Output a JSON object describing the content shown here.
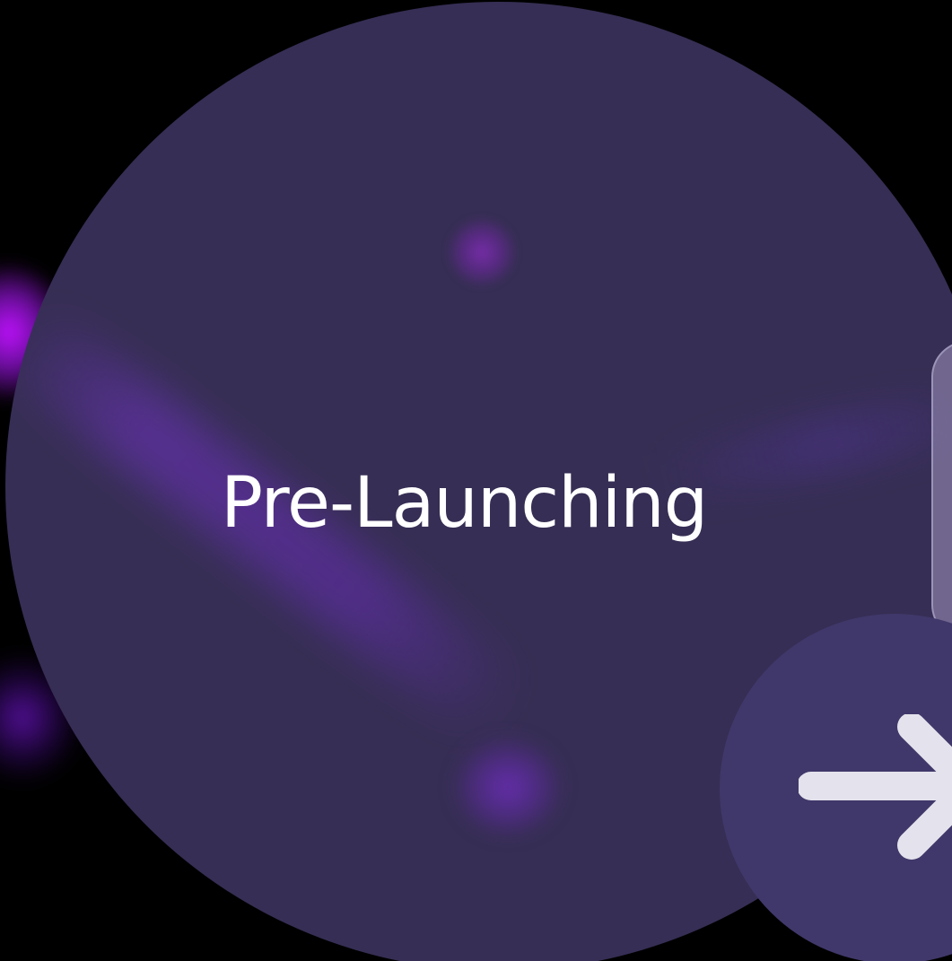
{
  "screen": {
    "title": "Pre-Launching"
  },
  "navigation": {
    "next_icon": "arrow-right-icon"
  },
  "colors": {
    "background": "#000000",
    "circle": "#362e54",
    "button": "#40386a",
    "accent_glow": "#c011ff",
    "text": "#ffffff"
  }
}
